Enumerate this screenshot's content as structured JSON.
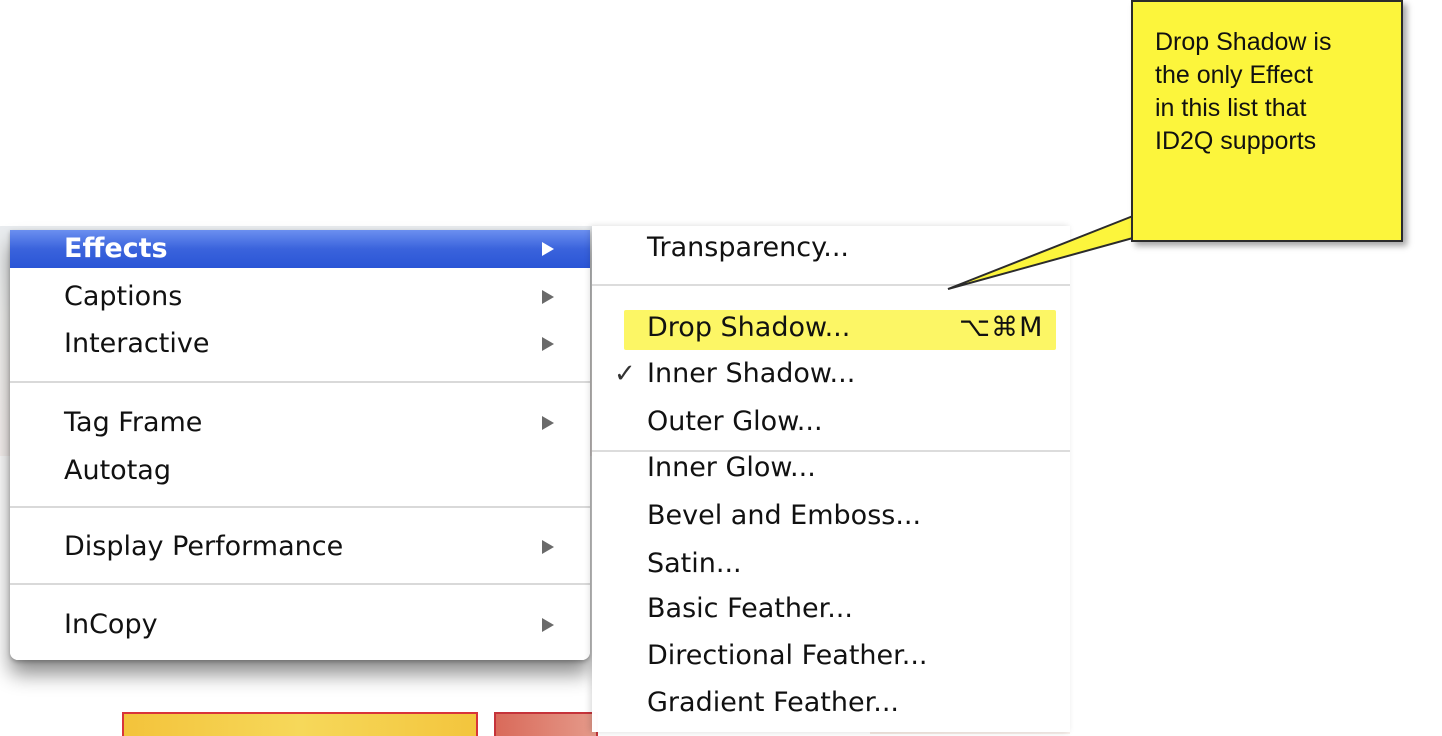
{
  "menu": {
    "items": [
      {
        "label": "Effects",
        "has_submenu": true,
        "active": true
      },
      {
        "label": "Captions",
        "has_submenu": true
      },
      {
        "label": "Interactive",
        "has_submenu": true
      },
      {
        "label": "Tag Frame",
        "has_submenu": true
      },
      {
        "label": "Autotag",
        "has_submenu": false
      },
      {
        "label": "Display Performance",
        "has_submenu": true
      },
      {
        "label": "InCopy",
        "has_submenu": true
      }
    ]
  },
  "submenu": {
    "items": [
      {
        "label": "Transparency..."
      },
      {
        "label": "Drop Shadow...",
        "shortcut": "⌥⌘M",
        "highlighted": true
      },
      {
        "label": "Inner Shadow...",
        "checked": true,
        "check_mark": "✓"
      },
      {
        "label": "Outer Glow..."
      },
      {
        "label": "Inner Glow..."
      },
      {
        "label": "Bevel and Emboss..."
      },
      {
        "label": "Satin..."
      },
      {
        "label": "Basic Feather..."
      },
      {
        "label": "Directional Feather..."
      },
      {
        "label": "Gradient Feather..."
      }
    ]
  },
  "callout": {
    "lines": [
      "Drop Shadow is",
      "the only Effect",
      "in this list that",
      "ID2Q supports"
    ]
  },
  "colors": {
    "menu_active": "#3a63dc",
    "highlight": "#fbf44a",
    "callout_fill": "#fcf53c"
  }
}
